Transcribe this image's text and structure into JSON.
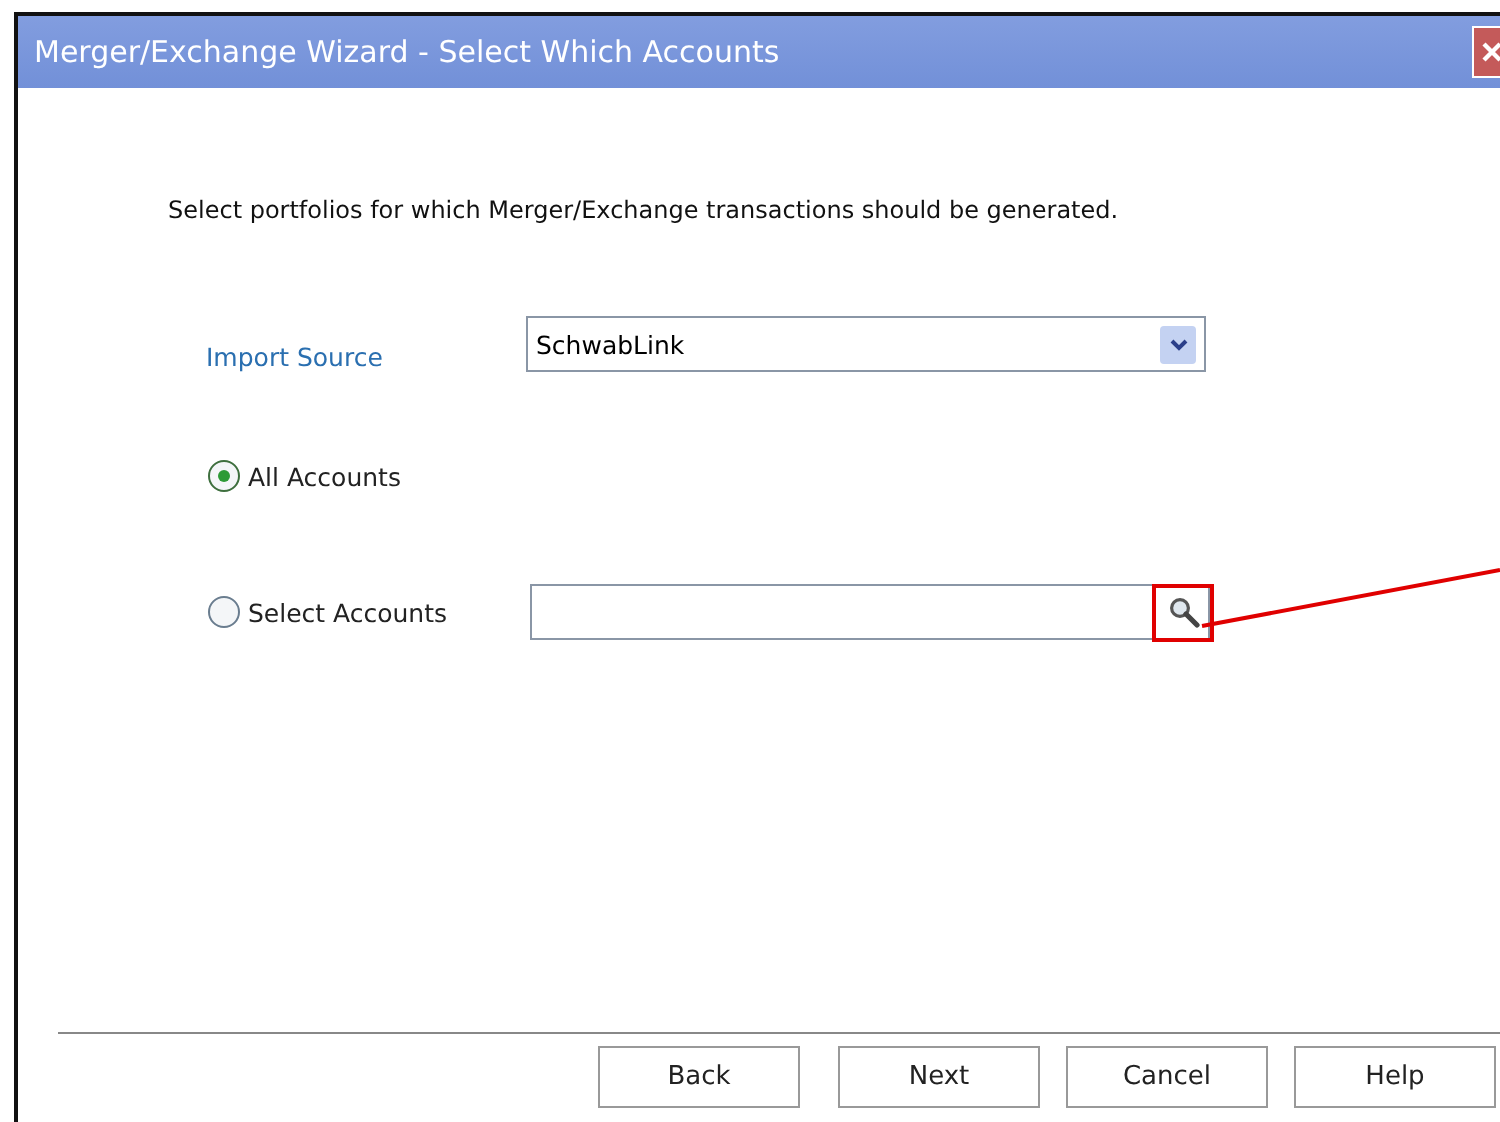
{
  "window": {
    "title": "Merger/Exchange Wizard - Select Which Accounts"
  },
  "instruction": "Select portfolios for which Merger/Exchange transactions should be generated.",
  "import_source": {
    "label": "Import Source",
    "value": "SchwabLink"
  },
  "options": [
    {
      "label": "All Accounts",
      "selected": true,
      "kind": "plain"
    },
    {
      "label": "Select Accounts",
      "selected": false,
      "kind": "lookup",
      "highlighted": true
    }
  ],
  "buttons": [
    "Back",
    "Next",
    "Cancel",
    "Help"
  ]
}
